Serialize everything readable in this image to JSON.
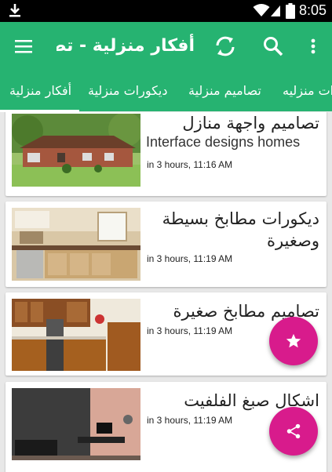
{
  "status_bar": {
    "time": "8:05",
    "icons": [
      "download-icon",
      "wifi-icon",
      "signal-icon",
      "battery-icon"
    ]
  },
  "toolbar": {
    "title": "أفكار منزلية - تص..",
    "icons": [
      "menu-icon",
      "refresh-icon",
      "search-icon",
      "more-vert-icon"
    ]
  },
  "tabs": [
    {
      "label": "أفكار منزلية",
      "active": true
    },
    {
      "label": "ديكورات منزلية",
      "active": false
    },
    {
      "label": "تصاميم منزلية",
      "active": false
    },
    {
      "label": "ات منزليه",
      "active": false
    }
  ],
  "posts": [
    {
      "title": "تصاميم واجهة منازل",
      "subtitle": "Interface designs homes",
      "time": "in 3 hours, 11:16 AM"
    },
    {
      "title": "ديكورات مطابخ بسيطة وصغيرة",
      "subtitle": "",
      "time": "in 3 hours, 11:19 AM"
    },
    {
      "title": "تصاميم مطابخ صغيرة",
      "subtitle": "",
      "time": "in 3 hours, 11:19 AM"
    },
    {
      "title": "اشكال صبغ الفلفيت",
      "subtitle": "",
      "time": "in 3 hours, 11:19 AM"
    }
  ],
  "fabs": {
    "favorite_icon": "star-icon",
    "share_icon": "share-icon"
  },
  "colors": {
    "primary": "#26b371",
    "fab": "#d81b8c",
    "status_bar": "#000000",
    "background": "#e8e8e8"
  }
}
